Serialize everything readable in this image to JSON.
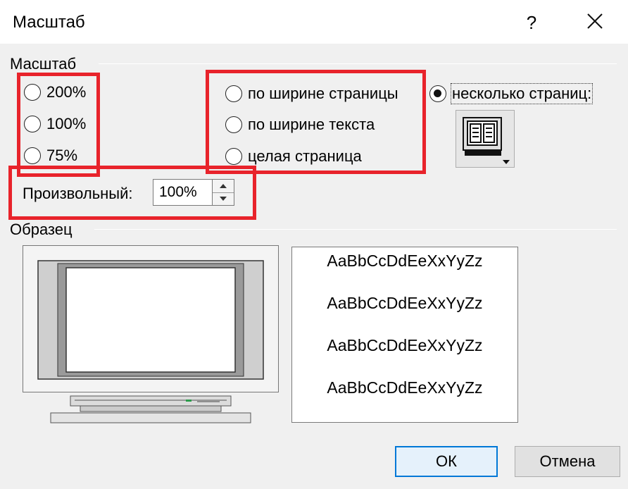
{
  "window": {
    "title": "Масштаб",
    "help_label": "?",
    "close_icon": "close-icon"
  },
  "zoom_group": {
    "label": "Масштаб",
    "presets": [
      {
        "label": "200%",
        "selected": false
      },
      {
        "label": "100%",
        "selected": false
      },
      {
        "label": "75%",
        "selected": false
      }
    ],
    "fit_options": [
      {
        "label": "по ширине страницы",
        "selected": false
      },
      {
        "label": "по ширине текста",
        "selected": false
      },
      {
        "label": "целая страница",
        "selected": false
      }
    ],
    "many_pages": {
      "label": "несколько страниц:",
      "selected": true
    },
    "pages_button_icon": "multi-page-monitor-icon",
    "custom": {
      "label": "Произвольный:",
      "value": "100%"
    }
  },
  "sample_group": {
    "label": "Образец",
    "lines": [
      "AaBbCcDdEeXxYyZz",
      "AaBbCcDdEeXxYyZz",
      "AaBbCcDdEeXxYyZz",
      "AaBbCcDdEeXxYyZz"
    ]
  },
  "buttons": {
    "ok": "ОК",
    "cancel": "Отмена"
  },
  "colors": {
    "highlight_red": "#e8232b",
    "default_button_border": "#0078d7"
  }
}
